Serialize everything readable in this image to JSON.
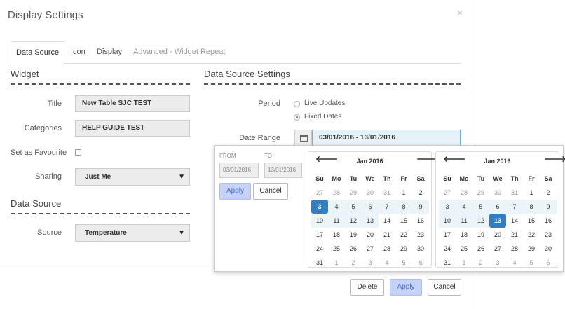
{
  "modal": {
    "title": "Display Settings",
    "close_glyph": "×",
    "tabs": [
      "Data Source",
      "Icon",
      "Display",
      "Advanced - Widget Repeat"
    ]
  },
  "widget": {
    "heading": "Widget",
    "title_label": "Title",
    "title_value": "New Table SJC TEST",
    "categories_label": "Categories",
    "categories_value": "HELP GUIDE TEST",
    "favourite_label": "Set as Favourite",
    "sharing_label": "Sharing",
    "sharing_value": "Just Me"
  },
  "data_source": {
    "heading": "Data Source",
    "source_label": "Source",
    "source_value": "Temperature"
  },
  "data_source_settings": {
    "heading": "Data Source Settings",
    "period_label": "Period",
    "period_options": [
      "Live Updates",
      "Fixed Dates"
    ],
    "period_selected": "Fixed Dates",
    "date_range_label": "Date Range",
    "date_range_value": "03/01/2016 - 13/01/2016"
  },
  "daterangepicker": {
    "from_label": "FROM",
    "to_label": "TO",
    "from_value": "03/01/2016",
    "to_value": "13/01/2016",
    "apply_label": "Apply",
    "cancel_label": "Cancel",
    "arrow_prev": "🡐",
    "arrow_next": "🡒",
    "weekdays": [
      "Su",
      "Mo",
      "Tu",
      "We",
      "Th",
      "Fr",
      "Sa"
    ],
    "calendars": [
      {
        "month": "Jan 2016",
        "weeks": [
          [
            "27",
            "28",
            "29",
            "30",
            "31",
            "1",
            "2"
          ],
          [
            "3",
            "4",
            "5",
            "6",
            "7",
            "8",
            "9"
          ],
          [
            "10",
            "11",
            "12",
            "13",
            "14",
            "15",
            "16"
          ],
          [
            "17",
            "18",
            "19",
            "20",
            "21",
            "22",
            "23"
          ],
          [
            "24",
            "25",
            "26",
            "27",
            "28",
            "29",
            "30"
          ],
          [
            "31",
            "1",
            "2",
            "3",
            "4",
            "5",
            "6"
          ]
        ]
      },
      {
        "month": "Jan 2016",
        "weeks": [
          [
            "27",
            "28",
            "29",
            "30",
            "31",
            "1",
            "2"
          ],
          [
            "3",
            "4",
            "5",
            "6",
            "7",
            "8",
            "9"
          ],
          [
            "10",
            "11",
            "12",
            "13",
            "14",
            "15",
            "16"
          ],
          [
            "17",
            "18",
            "19",
            "20",
            "21",
            "22",
            "23"
          ],
          [
            "24",
            "25",
            "26",
            "27",
            "28",
            "29",
            "30"
          ],
          [
            "31",
            "1",
            "2",
            "3",
            "4",
            "5",
            "6"
          ]
        ]
      }
    ]
  },
  "footer": {
    "delete_label": "Delete",
    "apply_label": "Apply",
    "cancel_label": "Cancel"
  },
  "colors": {
    "selected_day": "#357ebd",
    "range_highlight": "#ebf4f8",
    "primary_button": "#c6d3f9"
  }
}
